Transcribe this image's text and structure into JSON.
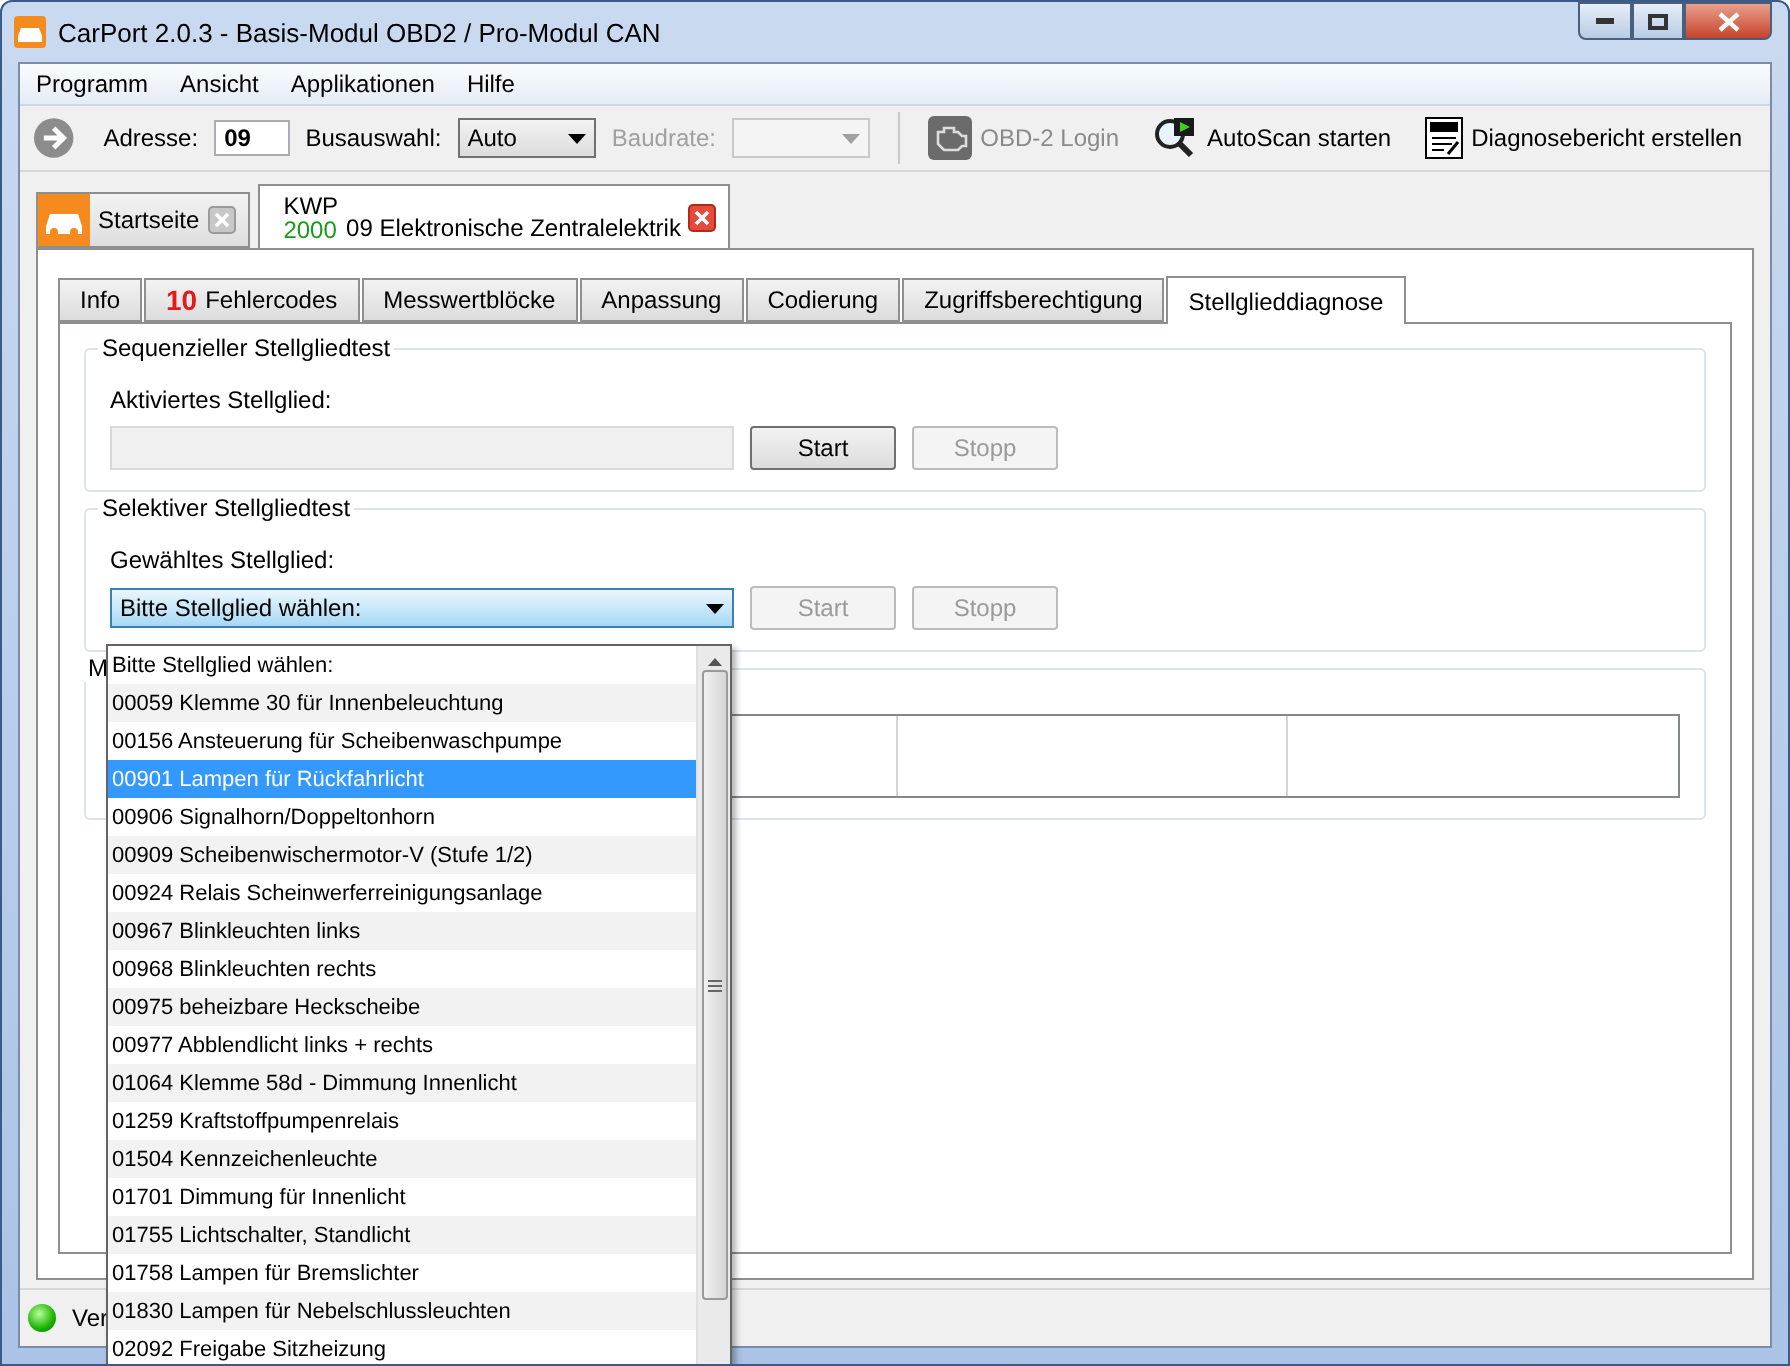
{
  "window": {
    "title": "CarPort 2.0.3  - Basis-Modul OBD2 / Pro-Modul CAN"
  },
  "menu": [
    {
      "label": "Programm"
    },
    {
      "label": "Ansicht"
    },
    {
      "label": "Applikationen"
    },
    {
      "label": "Hilfe"
    }
  ],
  "toolbar": {
    "address_label": "Adresse:",
    "address_value": "09",
    "bus_label": "Busauswahl:",
    "bus_value": "Auto",
    "baud_label": "Baudrate:",
    "baud_disabled": true,
    "actions": [
      {
        "kind": "engine",
        "label": "OBD-2 Login",
        "disabled": true
      },
      {
        "kind": "scan",
        "label": "AutoScan starten",
        "disabled": false
      },
      {
        "kind": "report",
        "label": "Diagnosebericht erstellen",
        "disabled": false
      }
    ]
  },
  "outer_tabs": [
    {
      "kind": "home",
      "label": "Startseite",
      "selected": false
    },
    {
      "kind": "module",
      "protocol": "KWP",
      "protocol_sub": "2000",
      "label": "09 Elektronische Zentralelektrik",
      "selected": true
    }
  ],
  "inner_tabs": [
    {
      "label": "Info",
      "selected": false
    },
    {
      "count": "10",
      "label": "Fehlercodes",
      "selected": false
    },
    {
      "label": "Messwertblöcke",
      "selected": false
    },
    {
      "label": "Anpassung",
      "selected": false
    },
    {
      "label": "Codierung",
      "selected": false
    },
    {
      "label": "Zugriffsberechtigung",
      "selected": false
    },
    {
      "label": "Stellglieddiagnose",
      "selected": true
    }
  ],
  "sequential": {
    "title": "Sequenzieller Stellgliedtest",
    "field_label": "Aktiviertes Stellglied:",
    "buttons": [
      {
        "label": "Start",
        "disabled": false
      },
      {
        "label": "Stopp",
        "disabled": true
      }
    ]
  },
  "selective": {
    "title": "Selektiver Stellgliedtest",
    "field_label": "Gewähltes Stellglied:",
    "select_value": "Bitte Stellglied wählen:",
    "buttons": [
      {
        "label": "Start",
        "disabled": true
      },
      {
        "label": "Stopp",
        "disabled": true
      }
    ]
  },
  "results": {
    "title": "M"
  },
  "dropdown": {
    "items": [
      {
        "label": "Bitte Stellglied wählen:",
        "selected": false
      },
      {
        "label": "00059 Klemme 30 für Innenbeleuchtung",
        "selected": false
      },
      {
        "label": "00156 Ansteuerung für Scheibenwaschpumpe",
        "selected": false
      },
      {
        "label": "00901 Lampen für Rückfahrlicht",
        "selected": true
      },
      {
        "label": "00906 Signalhorn/Doppeltonhorn",
        "selected": false
      },
      {
        "label": "00909 Scheibenwischermotor-V (Stufe 1/2)",
        "selected": false
      },
      {
        "label": "00924 Relais Scheinwerferreinigungsanlage",
        "selected": false
      },
      {
        "label": "00967 Blinkleuchten links",
        "selected": false
      },
      {
        "label": "00968 Blinkleuchten rechts",
        "selected": false
      },
      {
        "label": "00975 beheizbare Heckscheibe",
        "selected": false
      },
      {
        "label": "00977 Abblendlicht links + rechts",
        "selected": false
      },
      {
        "label": "01064 Klemme 58d - Dimmung Innenlicht",
        "selected": false
      },
      {
        "label": "01259 Kraftstoffpumpenrelais",
        "selected": false
      },
      {
        "label": "01504 Kennzeichenleuchte",
        "selected": false
      },
      {
        "label": "01701 Dimmung für Innenlicht",
        "selected": false
      },
      {
        "label": "01755 Lichtschalter, Standlicht",
        "selected": false
      },
      {
        "label": "01758 Lampen für Bremslichter",
        "selected": false
      },
      {
        "label": "01830 Lampen für Nebelschlussleuchten",
        "selected": false
      },
      {
        "label": "02092 Freigabe Sitzheizung",
        "selected": false
      }
    ]
  },
  "status_bar": {
    "connected": true,
    "text": "Ver"
  }
}
